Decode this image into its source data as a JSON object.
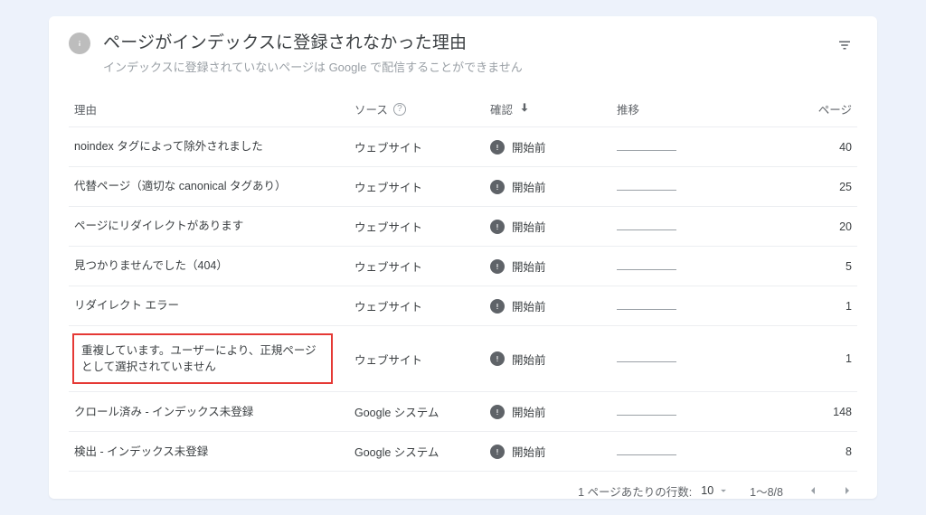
{
  "header": {
    "title": "ページがインデックスに登録されなかった理由",
    "subtitle": "インデックスに登録されていないページは Google で配信することができません"
  },
  "table": {
    "columns": {
      "reason": "理由",
      "source": "ソース",
      "confirm": "確認",
      "trend": "推移",
      "pages": "ページ"
    },
    "rows": [
      {
        "reason": "noindex タグによって除外されました",
        "source": "ウェブサイト",
        "status": "開始前",
        "pages": "40",
        "highlighted": false
      },
      {
        "reason": "代替ページ（適切な canonical タグあり）",
        "source": "ウェブサイト",
        "status": "開始前",
        "pages": "25",
        "highlighted": false
      },
      {
        "reason": "ページにリダイレクトがあります",
        "source": "ウェブサイト",
        "status": "開始前",
        "pages": "20",
        "highlighted": false
      },
      {
        "reason": "見つかりませんでした（404）",
        "source": "ウェブサイト",
        "status": "開始前",
        "pages": "5",
        "highlighted": false
      },
      {
        "reason": "リダイレクト エラー",
        "source": "ウェブサイト",
        "status": "開始前",
        "pages": "1",
        "highlighted": false
      },
      {
        "reason": "重複しています。ユーザーにより、正規ページとして選択されていません",
        "source": "ウェブサイト",
        "status": "開始前",
        "pages": "1",
        "highlighted": true
      },
      {
        "reason": "クロール済み - インデックス未登録",
        "source": "Google システム",
        "status": "開始前",
        "pages": "148",
        "highlighted": false
      },
      {
        "reason": "検出 - インデックス未登録",
        "source": "Google システム",
        "status": "開始前",
        "pages": "8",
        "highlighted": false
      }
    ]
  },
  "pagination": {
    "rows_per_page_label": "1 ページあたりの行数:",
    "rows_per_page_value": "10",
    "range": "1～8/8"
  }
}
